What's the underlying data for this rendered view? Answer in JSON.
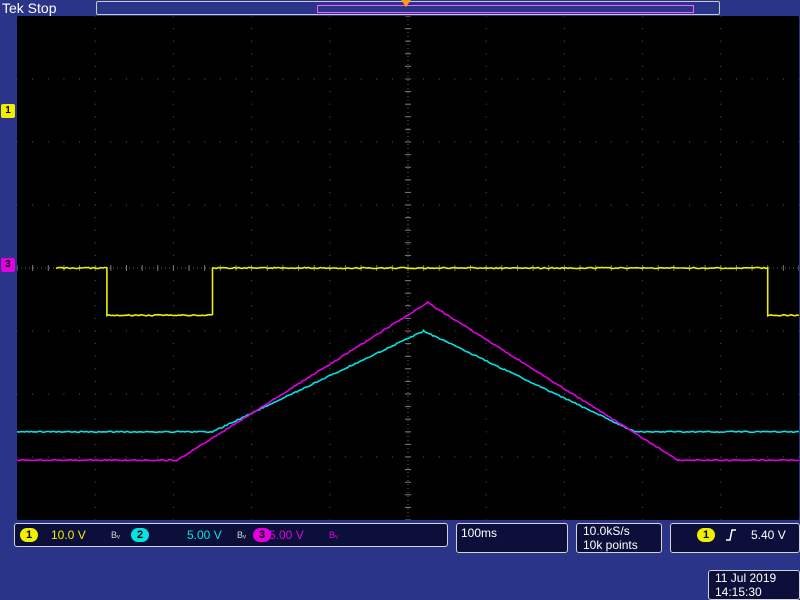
{
  "top": {
    "status": "Tek Stop"
  },
  "channels": [
    {
      "num": "1",
      "scale": "10.0 V",
      "bw": "Bᵥ",
      "color": "#f0ef00"
    },
    {
      "num": "2",
      "scale": "5.00 V",
      "bw": "Bᵥ",
      "color": "#00e4e4"
    },
    {
      "num": "3",
      "scale": "5.00 V",
      "bw": "Bᵥ",
      "color": "#e000e0"
    }
  ],
  "timebase": "100ms",
  "acquisition": {
    "rate": "10.0kS/s",
    "points": "10k points"
  },
  "trigger": {
    "source": "1",
    "slope_icon": "rising-edge-icon",
    "level": "5.40 V"
  },
  "datetime": {
    "date": "11 Jul  2019",
    "time": "14:15:30"
  },
  "markers": {
    "ch1": "1",
    "ch3": "3"
  },
  "chart_data": {
    "type": "line",
    "x": {
      "divisions": 10,
      "unit": "s/div",
      "per_div": 0.1
    },
    "y": {
      "divisions": 8
    },
    "grid": true,
    "series": [
      {
        "name": "1",
        "shape": "square",
        "color": "#f0ef00",
        "points_div": [
          [
            -4.5,
            0
          ],
          [
            -3.85,
            0
          ],
          [
            -3.85,
            -0.75
          ],
          [
            -2.5,
            -0.75
          ],
          [
            -2.5,
            0
          ],
          [
            4.6,
            0
          ],
          [
            4.6,
            -0.75
          ],
          [
            5.0,
            -0.75
          ]
        ]
      },
      {
        "name": "2",
        "shape": "triangle",
        "color": "#00e4e4",
        "points_div": [
          [
            -5.0,
            -2.6
          ],
          [
            -2.5,
            -2.6
          ],
          [
            0.2,
            -1.0
          ],
          [
            2.9,
            -2.6
          ],
          [
            5.0,
            -2.6
          ]
        ]
      },
      {
        "name": "3",
        "shape": "triangle",
        "color": "#e000e0",
        "points_div": [
          [
            -5.0,
            -3.05
          ],
          [
            -2.95,
            -3.05
          ],
          [
            0.25,
            -0.55
          ],
          [
            3.45,
            -3.05
          ],
          [
            5.0,
            -3.05
          ]
        ]
      }
    ]
  }
}
